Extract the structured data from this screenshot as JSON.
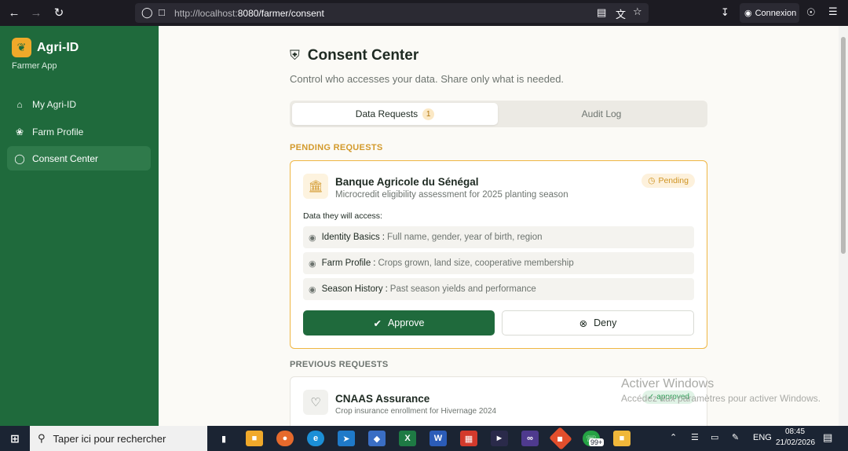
{
  "browser": {
    "url_host": "http://localhost:",
    "url_rest": "8080/farmer/consent",
    "signin_label": "Connexion"
  },
  "sidebar": {
    "brand_name": "Agri-ID",
    "brand_sub": "Farmer App",
    "items": [
      {
        "label": "My Agri-ID",
        "icon": "home-icon"
      },
      {
        "label": "Farm Profile",
        "icon": "leaf-icon"
      },
      {
        "label": "Consent Center",
        "icon": "shield-icon",
        "active": true
      }
    ]
  },
  "page": {
    "title": "Consent Center",
    "subtitle": "Control who accesses your data. Share only what is needed."
  },
  "tabs": {
    "requests_label": "Data Requests",
    "requests_count": "1",
    "audit_label": "Audit Log"
  },
  "pending": {
    "section_label": "PENDING REQUESTS",
    "institution": "Banque Agricole du Sénégal",
    "purpose": "Microcredit eligibility assessment for 2025 planting season",
    "status": "Pending",
    "access_label": "Data they will access:",
    "fields": [
      {
        "name": "Identity Basics",
        "desc": "Full name, gender, year of birth, region"
      },
      {
        "name": "Farm Profile",
        "desc": "Crops grown, land size, cooperative membership"
      },
      {
        "name": "Season History",
        "desc": "Past season yields and performance"
      }
    ],
    "approve_label": "Approve",
    "deny_label": "Deny"
  },
  "previous": {
    "section_label": "PREVIOUS REQUESTS",
    "institution": "CNAAS Assurance",
    "purpose": "Crop insurance enrollment for Hivernage 2024",
    "status": "approved"
  },
  "watermark": {
    "line1": "Activer Windows",
    "line2": "Accédez aux paramètres pour activer Windows."
  },
  "taskbar": {
    "search_placeholder": "Taper ici pour rechercher",
    "badge": "99+",
    "lang": "ENG",
    "time": "08:45",
    "date": "21/02/2026"
  },
  "colors": {
    "sidebar": "#1f6a3c",
    "accent": "#efb643",
    "approve": "#1f6a3c"
  }
}
